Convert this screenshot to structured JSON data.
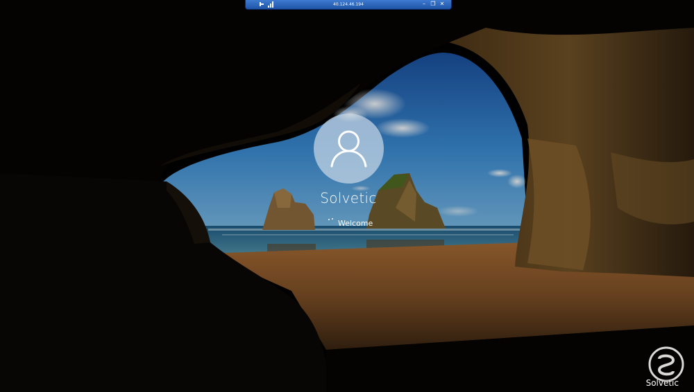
{
  "rdp_bar": {
    "host": "40.124.46.194",
    "icons": [
      "pin-icon",
      "connection-quality-icon",
      "minimize-icon",
      "restore-icon",
      "close-icon"
    ],
    "minimize_glyph": "–",
    "restore_glyph": "❐",
    "close_glyph": "✕"
  },
  "login": {
    "user_name": "Solvetic",
    "status": "Welcome",
    "avatar_icon": "user-icon"
  },
  "watermark": {
    "text": "Solvetic"
  },
  "colors": {
    "rdp_bar": "#2a63bb",
    "avatar_bg": "#c8d7e6",
    "text": "#ffffff"
  }
}
